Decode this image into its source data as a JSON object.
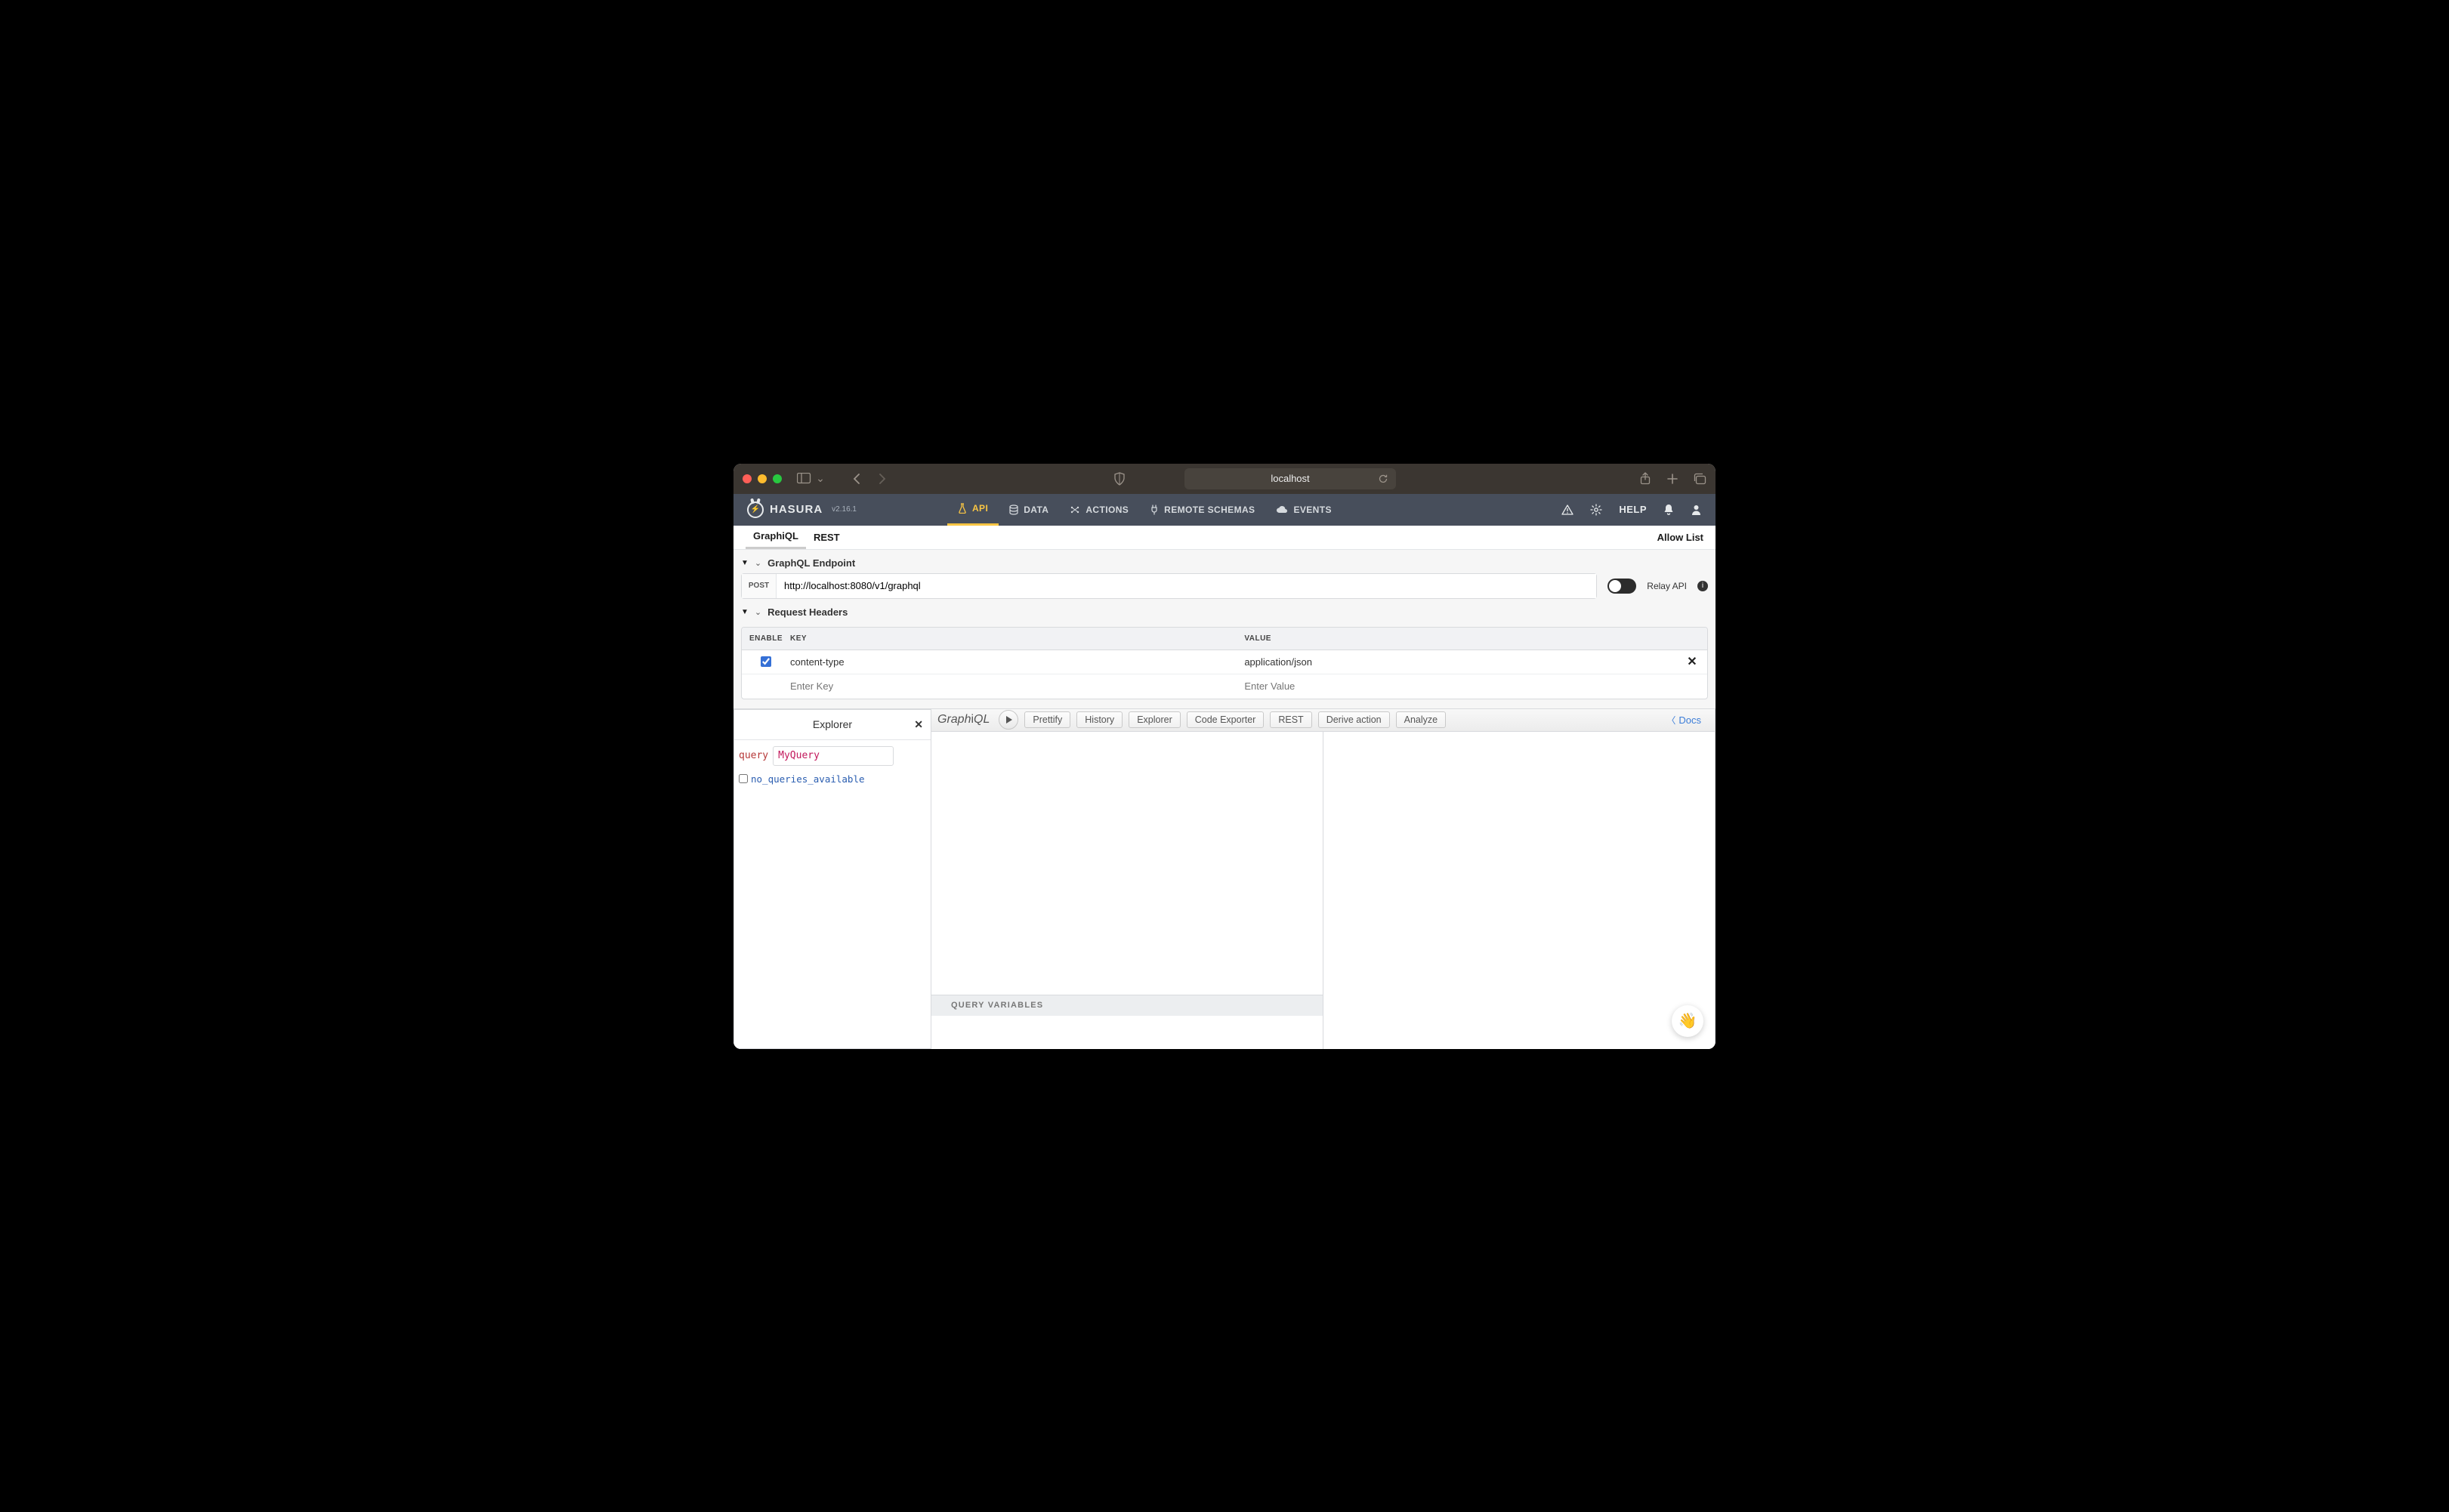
{
  "browser": {
    "url": "localhost"
  },
  "app": {
    "brand": "HASURA",
    "version": "v2.16.1",
    "nav": [
      "API",
      "DATA",
      "ACTIONS",
      "REMOTE SCHEMAS",
      "EVENTS"
    ],
    "help": "HELP"
  },
  "tabs": {
    "graphiql": "GraphiQL",
    "rest": "REST",
    "allow_list": "Allow List"
  },
  "endpoint": {
    "section_label": "GraphQL Endpoint",
    "method": "POST",
    "url": "http://localhost:8080/v1/graphql",
    "relay_label": "Relay API"
  },
  "headers": {
    "section_label": "Request Headers",
    "col_enable": "ENABLE",
    "col_key": "KEY",
    "col_value": "VALUE",
    "rows": [
      {
        "enabled": true,
        "key": "content-type",
        "value": "application/json"
      }
    ],
    "key_placeholder": "Enter Key",
    "value_placeholder": "Enter Value"
  },
  "explorer": {
    "title": "Explorer",
    "query_keyword": "query",
    "query_name": "MyQuery",
    "fields": [
      "no_queries_available"
    ]
  },
  "graphiql": {
    "logo": "GraphiQL",
    "buttons": [
      "Prettify",
      "History",
      "Explorer",
      "Code Exporter",
      "REST",
      "Derive action",
      "Analyze"
    ],
    "docs": "Docs",
    "query_variables_label": "QUERY VARIABLES"
  },
  "fab": {
    "emoji": "👋"
  }
}
